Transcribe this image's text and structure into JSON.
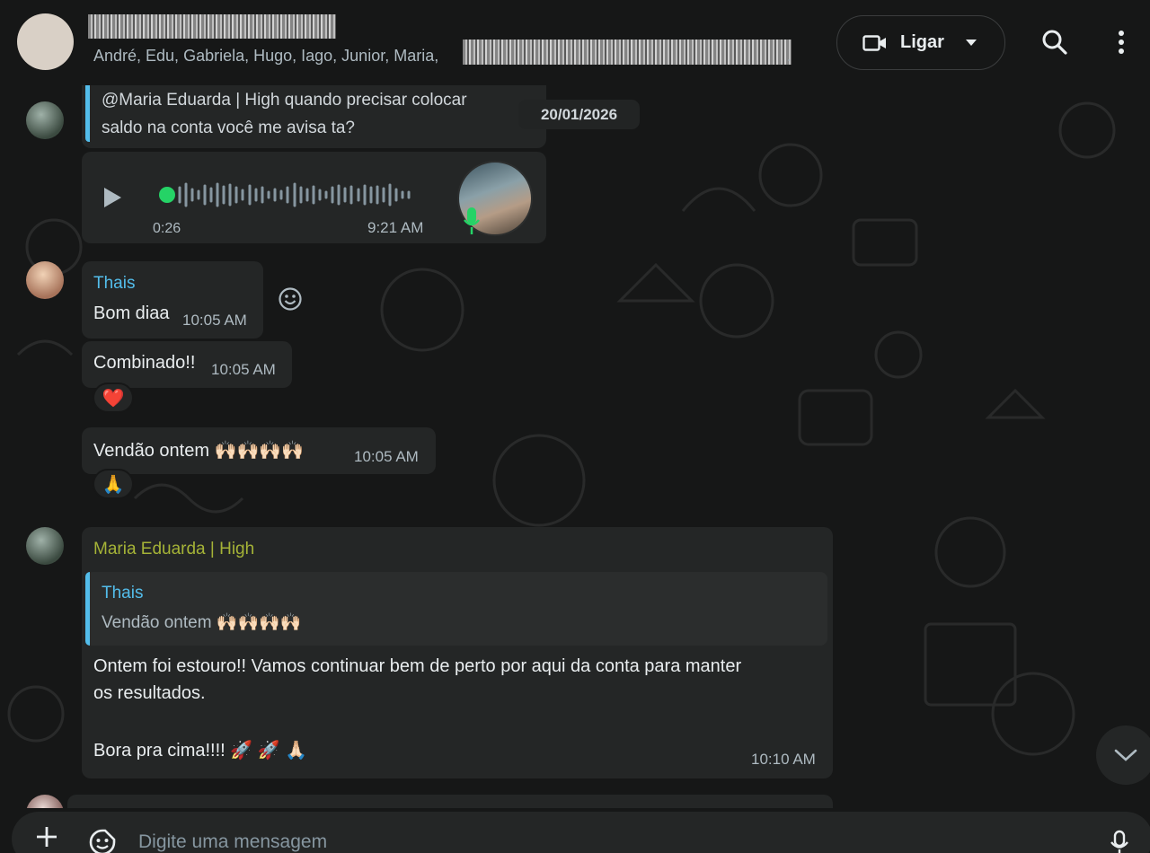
{
  "header": {
    "participants": "André, Edu, Gabriela, Hugo, Iago, Junior, Maria,",
    "participants_tail": ".",
    "call_label": "Ligar"
  },
  "chat": {
    "quoted_reply_text": "@Maria Eduarda | High quando precisar colocar saldo na conta você me avisa ta?",
    "date_chip": "20/01/2026",
    "voice_message": {
      "duration": "0:26",
      "time": "9:21 AM"
    },
    "messages": [
      {
        "sender": "Thais",
        "text": "Bom diaa",
        "time": "10:05 AM"
      },
      {
        "text": "Combinado!!",
        "time": "10:05 AM",
        "reaction": "❤️"
      },
      {
        "text": "Vendão ontem 🙌🏻🙌🏻🙌🏻🙌🏻",
        "time": "10:05 AM",
        "reaction": "🙏"
      }
    ],
    "reply_message": {
      "sender": "Maria Eduarda | High",
      "quoted_sender": "Thais",
      "quoted_text": "Vendão ontem 🙌🏻🙌🏻🙌🏻🙌🏻",
      "line1": "Ontem foi estouro!! Vamos continuar bem de perto por aqui da conta para manter",
      "line2": "os resultados.",
      "line3": "Bora pra cima!!!! 🚀 🚀 🙏🏻",
      "time": "10:10 AM"
    }
  },
  "composer": {
    "placeholder": "Digite uma mensagem"
  },
  "colors": {
    "background": "#161717",
    "bubble": "#242626",
    "accent_green": "#25d366",
    "sender_thais": "#53bdeb",
    "sender_maria": "#a5b337"
  }
}
